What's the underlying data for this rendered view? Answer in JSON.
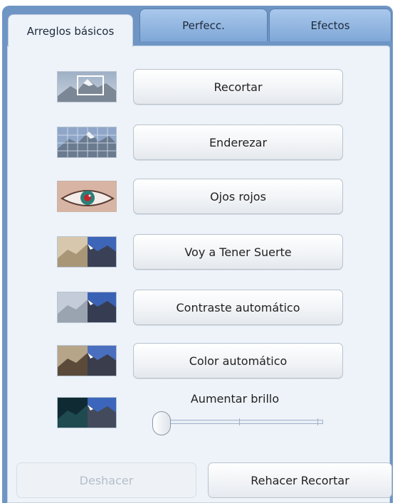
{
  "tabs": [
    {
      "label": "Arreglos básicos",
      "active": true
    },
    {
      "label": "Perfecc.",
      "active": false
    },
    {
      "label": "Efectos",
      "active": false
    }
  ],
  "actions": [
    {
      "label": "Recortar",
      "icon": "crop-thumbnail-icon"
    },
    {
      "label": "Enderezar",
      "icon": "straighten-thumbnail-icon"
    },
    {
      "label": "Ojos rojos",
      "icon": "red-eye-thumbnail-icon"
    },
    {
      "label": "Voy a Tener Suerte",
      "icon": "feeling-lucky-thumbnail-icon"
    },
    {
      "label": "Contraste automático",
      "icon": "auto-contrast-thumbnail-icon"
    },
    {
      "label": "Color automático",
      "icon": "auto-color-thumbnail-icon"
    }
  ],
  "fill_light": {
    "label": "Aumentar brillo",
    "value": 0,
    "icon": "fill-light-thumbnail-icon"
  },
  "footer": {
    "undo_label": "Deshacer",
    "redo_label": "Rehacer Recortar"
  },
  "colors": {
    "panel_blue": "#6f95c4",
    "content_bg": "#eef3f9",
    "red_eye": "#c0262c"
  }
}
